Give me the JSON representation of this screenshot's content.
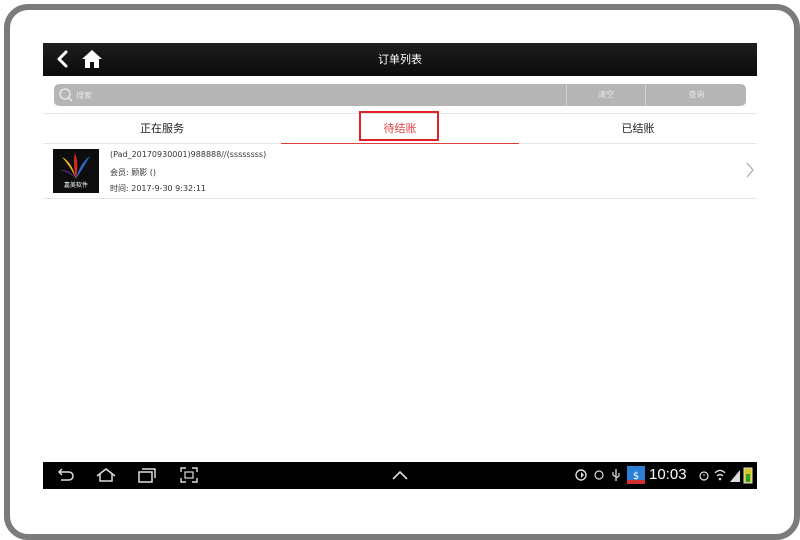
{
  "topbar": {
    "title": "订单列表"
  },
  "search": {
    "placeholder": "搜索",
    "clear_label": "清空",
    "query_label": "查询"
  },
  "tabs": [
    {
      "label": "正在服务"
    },
    {
      "label": "待结账",
      "active": true
    },
    {
      "label": "已结账"
    }
  ],
  "orders": [
    {
      "logo_text": "嘉美软件",
      "id_line": "(Pad_20170930001)988888//(ssssssss)",
      "member_line": "会员: 顾影 ()",
      "time_line": "时间: 2017-9-30 9:32:11"
    }
  ],
  "status_bar": {
    "time": "10:03"
  },
  "colors": {
    "accent": "#e04040",
    "topbar": "#111111",
    "search_bg": "#b5b5b5"
  }
}
